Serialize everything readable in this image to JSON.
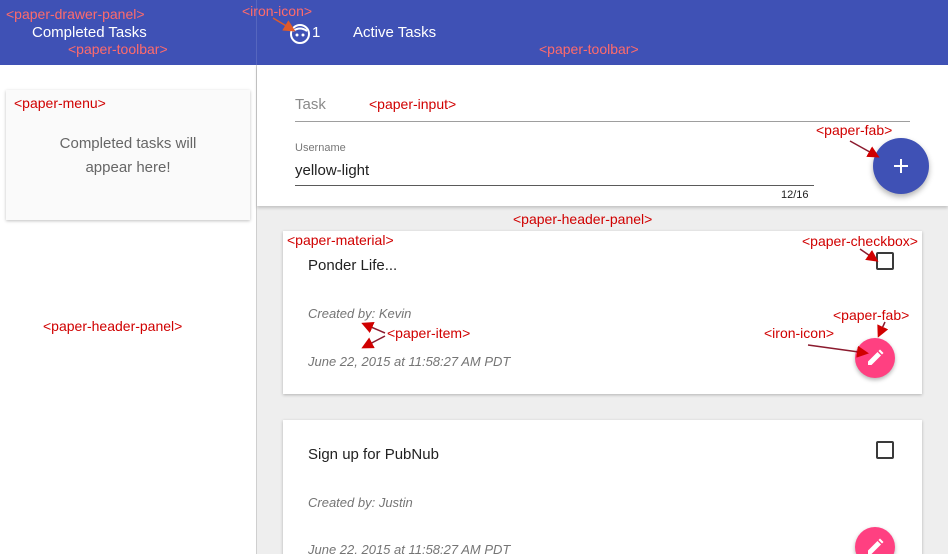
{
  "toolbar": {
    "drawer_title": "Completed Tasks",
    "user_icon": "face-icon",
    "count": "1",
    "main_title": "Active Tasks"
  },
  "drawer": {
    "empty_message_line1": "Completed tasks will",
    "empty_message_line2": "appear here!"
  },
  "form": {
    "task_placeholder": "Task",
    "username_label": "Username",
    "username_value": "yellow-light",
    "char_count": "12/16",
    "add_icon": "add-icon"
  },
  "tasks": [
    {
      "title": "Ponder Life...",
      "created_by": "Created by: Kevin",
      "date": "June 22, 2015 at 11:58:27 AM PDT",
      "edit_icon": "edit-icon"
    },
    {
      "title": "Sign up for PubNub",
      "created_by": "Created by: Justin",
      "date": "June 22, 2015 at 11:58:27 AM PDT",
      "edit_icon": "edit-icon"
    }
  ],
  "annotations": {
    "drawer_panel": "<paper-drawer-panel>",
    "iron_icon_top": "<iron-icon>",
    "toolbar_left": "<paper-toolbar>",
    "toolbar_right": "<paper-toolbar>",
    "paper_menu": "<paper-menu>",
    "paper_input": "<paper-input>",
    "paper_fab_top": "<paper-fab>",
    "header_panel_main": "<paper-header-panel>",
    "paper_material": "<paper-material>",
    "paper_checkbox": "<paper-checkbox>",
    "header_panel_drawer": "<paper-header-panel>",
    "paper_item": "<paper-item>",
    "paper_fab_card": "<paper-fab>",
    "iron_icon_card": "<iron-icon>"
  },
  "colors": {
    "primary": "#3f51b5",
    "accent": "#ff4081",
    "annotation": "#d00000"
  }
}
